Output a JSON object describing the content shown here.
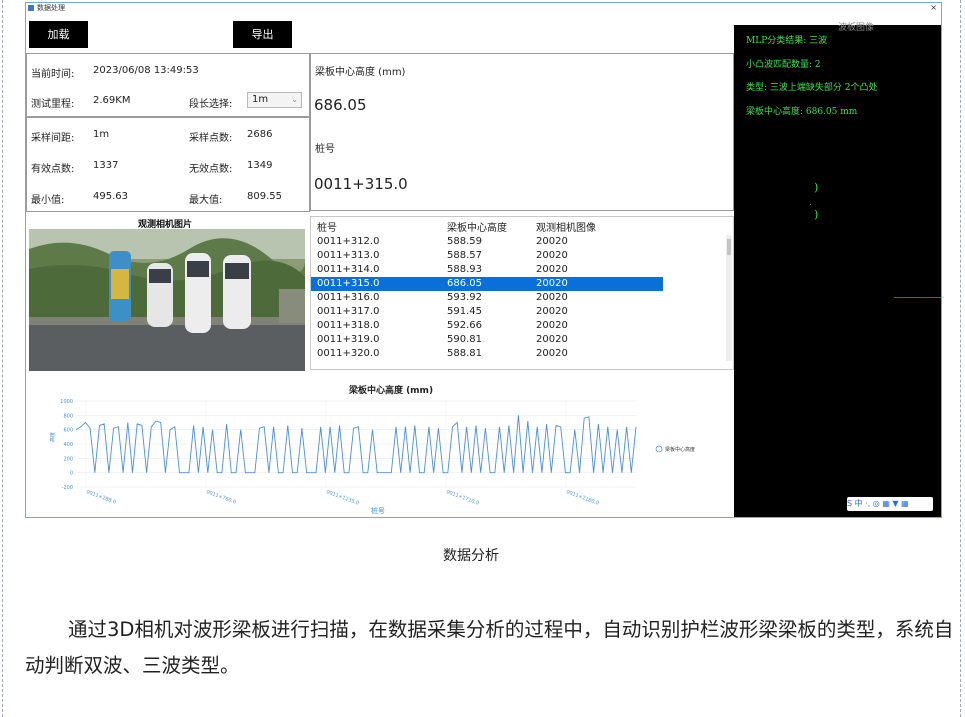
{
  "window": {
    "title": "数据处理",
    "close": "×"
  },
  "toolbar": {
    "load_label": "加载",
    "export_label": "导出"
  },
  "info": {
    "time_label": "当前时间:",
    "time_value": "2023/06/08 13:49:53",
    "mileage_label": "测试里程:",
    "mileage_value": "2.69KM",
    "segment_label": "段长选择:",
    "segment_value": "1m",
    "interval_label": "采样间距:",
    "interval_value": "1m",
    "samples_label": "采样点数:",
    "samples_value": "2686",
    "valid_label": "有效点数:",
    "valid_value": "1337",
    "invalid_label": "无效点数:",
    "invalid_value": "1349",
    "min_label": "最小值:",
    "min_value": "495.63",
    "max_label": "最大值:",
    "max_value": "809.55"
  },
  "detail": {
    "height_label": "梁板中心高度 (mm)",
    "height_value": "686.05",
    "pile_label": "桩号",
    "pile_value": "0011+315.0"
  },
  "camera": {
    "title": "观测相机图片"
  },
  "table": {
    "headers": [
      "桩号",
      "梁板中心高度",
      "观测相机图像"
    ],
    "rows": [
      [
        "0011+312.0",
        "588.59",
        "20020"
      ],
      [
        "0011+313.0",
        "588.57",
        "20020"
      ],
      [
        "0011+314.0",
        "588.93",
        "20020"
      ],
      [
        "0011+315.0",
        "686.05",
        "20020"
      ],
      [
        "0011+316.0",
        "593.92",
        "20020"
      ],
      [
        "0011+317.0",
        "591.45",
        "20020"
      ],
      [
        "0011+318.0",
        "592.66",
        "20020"
      ],
      [
        "0011+319.0",
        "590.81",
        "20020"
      ],
      [
        "0011+320.0",
        "588.81",
        "20020"
      ]
    ],
    "selected": 3
  },
  "chart_data": {
    "type": "line",
    "title": "梁板中心高度 (mm)",
    "xlabel": "桩号",
    "ylabel": "高度",
    "ylim": [
      -200,
      1000
    ],
    "yticks": [
      1000,
      800,
      600,
      400,
      200,
      0,
      -200
    ],
    "xticks": [
      "0011+288.0",
      "0011+760.0",
      "0011+1235.0",
      "0011+1710.0",
      "0011+2180.0"
    ],
    "series": [
      {
        "name": "梁板中心高度",
        "color": "#4a90d9",
        "values": [
          600,
          640,
          700,
          620,
          0,
          660,
          680,
          0,
          620,
          640,
          0,
          700,
          0,
          680,
          660,
          0,
          640,
          720,
          700,
          0,
          600,
          640,
          0,
          0,
          0,
          660,
          0,
          640,
          0,
          600,
          0,
          0,
          680,
          0,
          0,
          600,
          0,
          0,
          0,
          620,
          640,
          0,
          640,
          0,
          0,
          660,
          0,
          0,
          620,
          0,
          0,
          0,
          640,
          0,
          640,
          0,
          660,
          0,
          0,
          620,
          640,
          0,
          0,
          600,
          0,
          0,
          0,
          0,
          640,
          0,
          640,
          0,
          660,
          0,
          0,
          640,
          0,
          620,
          0,
          0,
          640,
          700,
          0,
          640,
          0,
          660,
          0,
          620,
          0,
          0,
          640,
          0,
          660,
          0,
          800,
          0,
          720,
          0,
          640,
          0,
          680,
          0,
          660,
          640,
          0,
          0,
          600,
          0,
          760,
          780,
          0,
          680,
          0,
          640,
          0,
          600,
          0,
          640,
          0,
          640
        ]
      }
    ],
    "legend": "right"
  },
  "overlay": {
    "title": "波板图像",
    "lines": [
      "MLP分类结果: 三波",
      "小凸波匹配数量: 2",
      "类型: 三波上端缺失部分 2个凸处",
      "梁板中心高度: 686.05 mm"
    ],
    "marks": [
      ")",
      ".",
      ")"
    ],
    "tray": "S 中 ·, ◎ ▦ ▼ ▦"
  },
  "caption": "数据分析",
  "paragraph": "通过3D相机对波形梁板进行扫描，在数据采集分析的过程中，自动识别护栏波形梁梁板的类型，系统自动判断双波、三波类型。"
}
